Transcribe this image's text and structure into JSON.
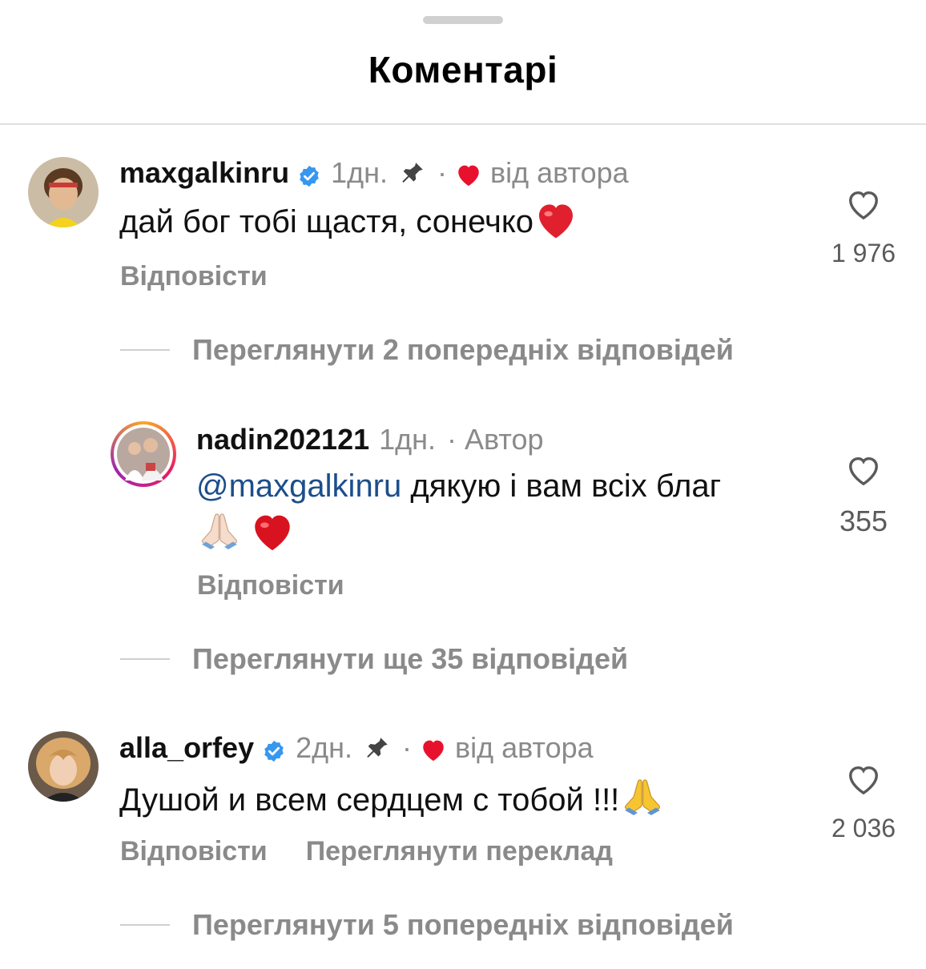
{
  "sheet": {
    "title": "Коментарі"
  },
  "comments": [
    {
      "username": "maxgalkinru",
      "verified": true,
      "time": "1дн.",
      "pinned": true,
      "dot": "·",
      "author_liked_label": "від автора",
      "text": "дай бог тобі щастя, сонечко",
      "text_emoji": "red-heart",
      "actions": [
        "Відповісти"
      ],
      "likes": "1 976",
      "view_replies": "Переглянути 2 попередніх відповідей"
    },
    {
      "username": "nadin202121",
      "verified": false,
      "time": "1дн.",
      "dot": "·",
      "role_label": "Автор",
      "mention": "@maxgalkinru",
      "text": " дякую і вам всіх благ",
      "text_emojis": [
        "folded-hands",
        "red-heart"
      ],
      "actions": [
        "Відповісти"
      ],
      "likes": "355",
      "view_replies": "Переглянути ще 35 відповідей"
    },
    {
      "username": "alla_orfey",
      "verified": true,
      "time": "2дн.",
      "pinned": true,
      "dot": "·",
      "author_liked_label": "від автора",
      "text": "Душой и всем сердцем с тобой !!!",
      "text_emoji": "folded-hands",
      "actions": [
        "Відповісти",
        "Переглянути переклад"
      ],
      "likes": "2 036",
      "view_replies": "Переглянути 5 попередніх відповідей"
    }
  ],
  "colors": {
    "accent_heart": "#e8112d",
    "mention": "#1c4e8b",
    "secondary_text": "#8a8a8a",
    "verified_badge": "#3797f0"
  }
}
